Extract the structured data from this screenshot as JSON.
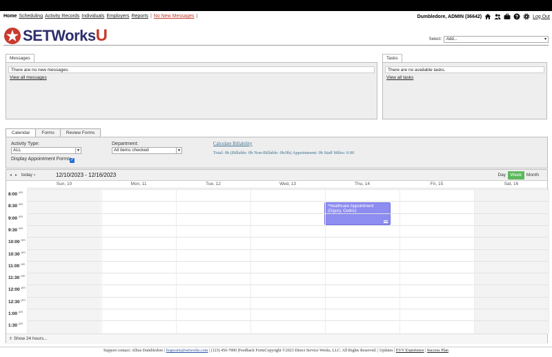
{
  "nav": {
    "home": "Home",
    "items": [
      "Scheduling",
      "Activity Records",
      "Individuals",
      "Employers",
      "Reports"
    ],
    "messages": "No New Messages",
    "user": "Dumbledore, ADMIN  (36642)",
    "logout": "Log Out",
    "icons": [
      "home-icon",
      "people-icon",
      "briefcase-icon",
      "help-icon",
      "gear-icon"
    ]
  },
  "brand": {
    "name_main": "SETWorks",
    "name_accent": "U",
    "accent_color": "#c83a2c",
    "primary_color": "#2d2d6b"
  },
  "select": {
    "label": "Select:",
    "value": "Add..."
  },
  "messages_panel": {
    "tab": "Messages",
    "text": "There are no new messages.",
    "link": "View all messages"
  },
  "tasks_panel": {
    "tab": "Tasks",
    "text": "There are no available tasks.",
    "link": "View all tasks"
  },
  "cal_tabs": [
    "Calendar",
    "Forms",
    "Review Forms"
  ],
  "filters": {
    "activity_label": "Activity Type:",
    "activity_value": "ALL",
    "department_label": "Department:",
    "department_value": "All items checked",
    "display_forms_label": "Display Appointment Forms:",
    "calc_link": "Calculate Billability",
    "totals": "Total: 0h   (Billable: 0h   Non-Billable: 0h/0h)   Appointment: 0h   Staff Miles: 0.00"
  },
  "calendar": {
    "today": "today",
    "range": "12/10/2023 - 12/16/2023",
    "views": [
      "Day",
      "Week",
      "Month"
    ],
    "active_view": "Week",
    "days": [
      "Sun, 10",
      "Mon, 11",
      "Tue, 12",
      "Wed, 13",
      "Thu, 14",
      "Fri, 15",
      "Sat, 16"
    ],
    "times": [
      {
        "t": "8:00",
        "p": "am"
      },
      {
        "t": "8:30",
        "p": "am"
      },
      {
        "t": "9:00",
        "p": "am"
      },
      {
        "t": "9:30",
        "p": "am"
      },
      {
        "t": "10:00",
        "p": "am"
      },
      {
        "t": "10:30",
        "p": "am"
      },
      {
        "t": "11:00",
        "p": "am"
      },
      {
        "t": "11:30",
        "p": "am"
      },
      {
        "t": "12:00",
        "p": "pm"
      },
      {
        "t": "12:30",
        "p": "pm"
      },
      {
        "t": "1:00",
        "p": "pm"
      },
      {
        "t": "1:30",
        "p": "pm"
      }
    ],
    "event": {
      "title": "*Healthcare Appointment (Digory, Cedric)",
      "color": "#8d8cf0"
    },
    "show24": "Show 24 hours..."
  },
  "footer": {
    "contact": "Support contact: Albus Dumbledore |",
    "email": "hogwarts@setworks.com",
    "rest": "| (123) 456-7890 |Feedback FormCopyright ©2023 Direct Service Works, LLC. All Rights Reserved.  |  Updates  |",
    "evv": "EVV Experience",
    "sep": "|",
    "success": "Success Plan"
  }
}
